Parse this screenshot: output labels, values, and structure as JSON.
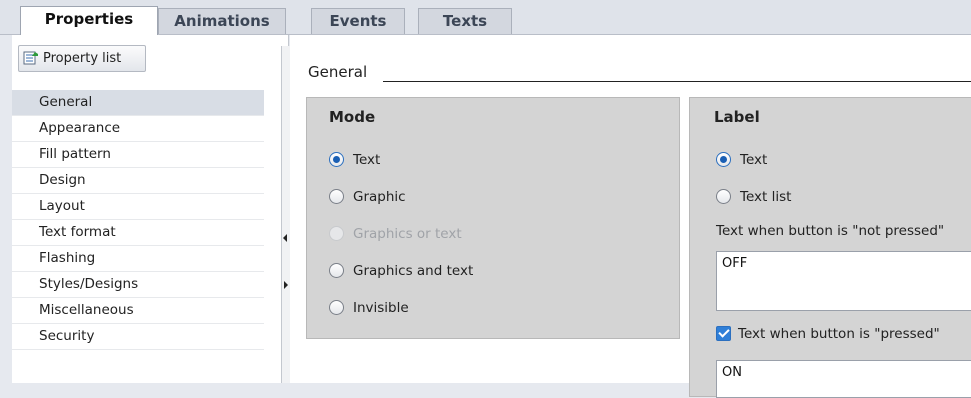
{
  "tabs": [
    {
      "label": "Properties",
      "active": true
    },
    {
      "label": "Animations",
      "active": false
    },
    {
      "label": "Events",
      "active": false
    },
    {
      "label": "Texts",
      "active": false
    }
  ],
  "left": {
    "property_list_button": "Property list",
    "nav": [
      {
        "label": "General",
        "selected": true
      },
      {
        "label": "Appearance"
      },
      {
        "label": "Fill pattern"
      },
      {
        "label": "Design"
      },
      {
        "label": "Layout"
      },
      {
        "label": "Text format"
      },
      {
        "label": "Flashing"
      },
      {
        "label": "Styles/Designs"
      },
      {
        "label": "Miscellaneous"
      },
      {
        "label": "Security"
      }
    ]
  },
  "main": {
    "section_title": "General",
    "mode": {
      "title": "Mode",
      "options": [
        {
          "label": "Text",
          "checked": true,
          "disabled": false
        },
        {
          "label": "Graphic",
          "checked": false,
          "disabled": false
        },
        {
          "label": "Graphics or text",
          "checked": false,
          "disabled": true
        },
        {
          "label": "Graphics and text",
          "checked": false,
          "disabled": false
        },
        {
          "label": "Invisible",
          "checked": false,
          "disabled": false
        }
      ]
    },
    "label": {
      "title": "Label",
      "options": [
        {
          "label": "Text",
          "checked": true
        },
        {
          "label": "Text list",
          "checked": false
        }
      ],
      "not_pressed_label": "Text when button is \"not pressed\"",
      "not_pressed_value": "OFF",
      "pressed_checkbox_label": "Text when button is \"pressed\"",
      "pressed_checked": true,
      "pressed_value": "ON"
    }
  },
  "colors": {
    "accent": "#1a5fb4",
    "groupbox": "#d4d4d4",
    "selected_row": "#d8dde5"
  }
}
